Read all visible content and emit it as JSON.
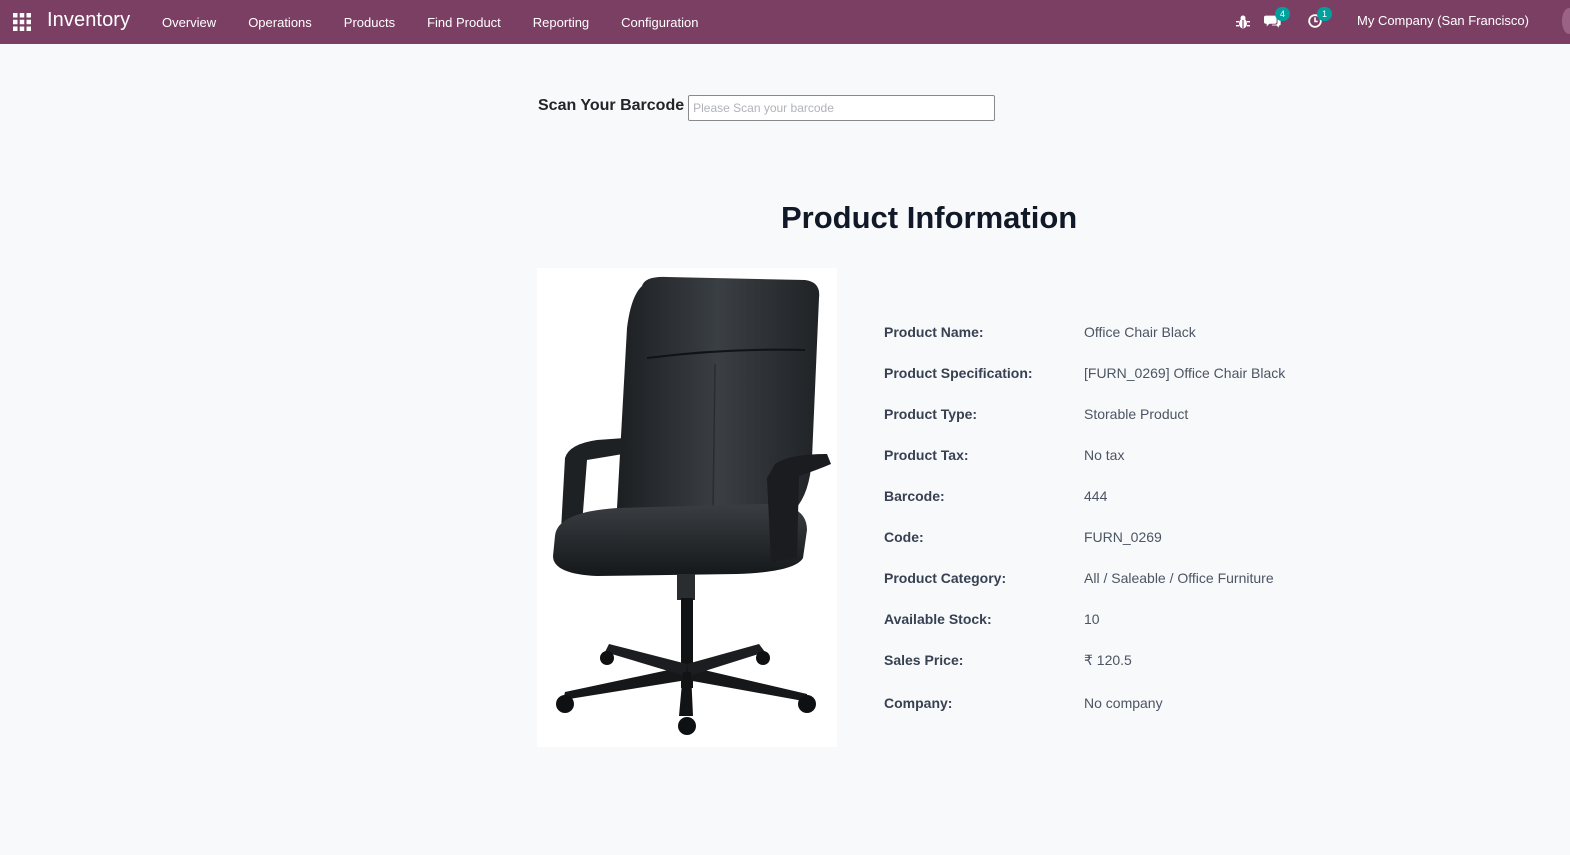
{
  "navbar": {
    "app_title": "Inventory",
    "menu": [
      "Overview",
      "Operations",
      "Products",
      "Find Product",
      "Reporting",
      "Configuration"
    ],
    "messages_count": "4",
    "activities_count": "1",
    "company": "My Company (San Francisco)"
  },
  "scan": {
    "label": "Scan Your Barcode",
    "placeholder": "Please Scan your barcode",
    "value": ""
  },
  "product": {
    "title": "Product Information",
    "fields": [
      {
        "label": "Product Name:",
        "value": "Office Chair Black"
      },
      {
        "label": "Product Specification:",
        "value": "[FURN_0269] Office Chair Black"
      },
      {
        "label": "Product Type:",
        "value": "Storable Product"
      },
      {
        "label": "Product Tax:",
        "value": "No tax"
      },
      {
        "label": "Barcode:",
        "value": "444"
      },
      {
        "label": "Code:",
        "value": "FURN_0269"
      },
      {
        "label": "Product Category:",
        "value": "All / Saleable / Office Furniture"
      },
      {
        "label": "Available Stock:",
        "value": "10"
      },
      {
        "label": "Sales Price:",
        "value": "₹ 120.5"
      },
      {
        "label": "Company:",
        "value": "No company"
      }
    ]
  },
  "colors": {
    "navbar": "#7c3f64",
    "badge": "#00a09d",
    "background": "#f8f9fb"
  },
  "icons": [
    "apps-grid-icon",
    "bug-icon",
    "chat-icon",
    "activity-clock-icon"
  ]
}
